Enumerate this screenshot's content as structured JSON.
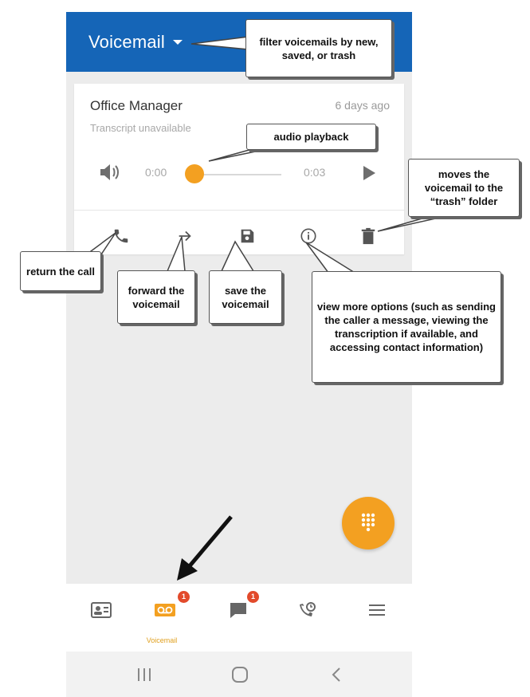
{
  "header": {
    "title": "Voicemail",
    "dropdown_icon": "caret-down-icon"
  },
  "voicemail_card": {
    "caller": "Office Manager",
    "age": "6 days ago",
    "transcript": "Transcript unavailable",
    "player": {
      "elapsed": "0:00",
      "duration": "0:03",
      "progress": 0.0
    },
    "actions": [
      {
        "name": "return-call",
        "icon": "phone-icon"
      },
      {
        "name": "forward",
        "icon": "arrow-right-icon"
      },
      {
        "name": "save",
        "icon": "save-icon"
      },
      {
        "name": "info",
        "icon": "info-icon"
      },
      {
        "name": "delete",
        "icon": "trash-icon"
      }
    ]
  },
  "callouts": {
    "filter": "filter voicemails by new, saved, or trash",
    "audio": "audio playback",
    "trash": "moves the voicemail to the “trash” folder",
    "return_call": "return the call",
    "forward": "forward the voicemail",
    "save": "save the voicemail",
    "options": "view more options (such as sending the caller a message, viewing the transcription if available, and accessing contact information)"
  },
  "bottom_nav": {
    "items": [
      {
        "icon": "contacts-icon"
      },
      {
        "icon": "voicemail-icon",
        "label": "Voicemail",
        "badge": "1",
        "active": true
      },
      {
        "icon": "chat-icon",
        "badge": "1"
      },
      {
        "icon": "call-history-icon"
      },
      {
        "icon": "menu-icon"
      }
    ]
  },
  "fab": {
    "icon": "dialpad-icon"
  },
  "system_nav": {
    "icons": [
      "recents-icon",
      "home-icon",
      "back-icon"
    ]
  },
  "colors": {
    "header": "#1565b7",
    "accent": "#f3a021",
    "badge": "#e24a2b"
  }
}
